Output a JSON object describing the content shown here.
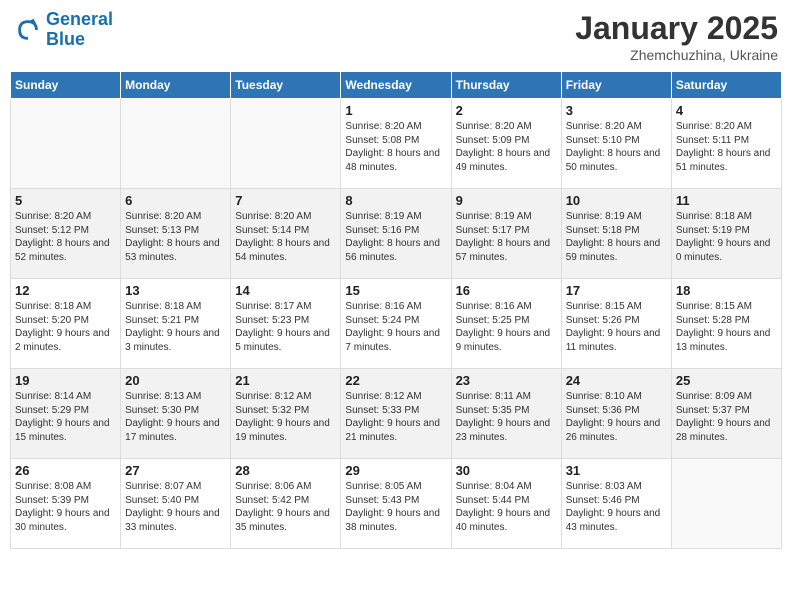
{
  "logo": {
    "line1": "General",
    "line2": "Blue"
  },
  "title": "January 2025",
  "subtitle": "Zhemchuzhina, Ukraine",
  "days_of_week": [
    "Sunday",
    "Monday",
    "Tuesday",
    "Wednesday",
    "Thursday",
    "Friday",
    "Saturday"
  ],
  "weeks": [
    [
      {
        "day": "",
        "sunrise": "",
        "sunset": "",
        "daylight": ""
      },
      {
        "day": "",
        "sunrise": "",
        "sunset": "",
        "daylight": ""
      },
      {
        "day": "",
        "sunrise": "",
        "sunset": "",
        "daylight": ""
      },
      {
        "day": "1",
        "sunrise": "Sunrise: 8:20 AM",
        "sunset": "Sunset: 5:08 PM",
        "daylight": "Daylight: 8 hours and 48 minutes."
      },
      {
        "day": "2",
        "sunrise": "Sunrise: 8:20 AM",
        "sunset": "Sunset: 5:09 PM",
        "daylight": "Daylight: 8 hours and 49 minutes."
      },
      {
        "day": "3",
        "sunrise": "Sunrise: 8:20 AM",
        "sunset": "Sunset: 5:10 PM",
        "daylight": "Daylight: 8 hours and 50 minutes."
      },
      {
        "day": "4",
        "sunrise": "Sunrise: 8:20 AM",
        "sunset": "Sunset: 5:11 PM",
        "daylight": "Daylight: 8 hours and 51 minutes."
      }
    ],
    [
      {
        "day": "5",
        "sunrise": "Sunrise: 8:20 AM",
        "sunset": "Sunset: 5:12 PM",
        "daylight": "Daylight: 8 hours and 52 minutes."
      },
      {
        "day": "6",
        "sunrise": "Sunrise: 8:20 AM",
        "sunset": "Sunset: 5:13 PM",
        "daylight": "Daylight: 8 hours and 53 minutes."
      },
      {
        "day": "7",
        "sunrise": "Sunrise: 8:20 AM",
        "sunset": "Sunset: 5:14 PM",
        "daylight": "Daylight: 8 hours and 54 minutes."
      },
      {
        "day": "8",
        "sunrise": "Sunrise: 8:19 AM",
        "sunset": "Sunset: 5:16 PM",
        "daylight": "Daylight: 8 hours and 56 minutes."
      },
      {
        "day": "9",
        "sunrise": "Sunrise: 8:19 AM",
        "sunset": "Sunset: 5:17 PM",
        "daylight": "Daylight: 8 hours and 57 minutes."
      },
      {
        "day": "10",
        "sunrise": "Sunrise: 8:19 AM",
        "sunset": "Sunset: 5:18 PM",
        "daylight": "Daylight: 8 hours and 59 minutes."
      },
      {
        "day": "11",
        "sunrise": "Sunrise: 8:18 AM",
        "sunset": "Sunset: 5:19 PM",
        "daylight": "Daylight: 9 hours and 0 minutes."
      }
    ],
    [
      {
        "day": "12",
        "sunrise": "Sunrise: 8:18 AM",
        "sunset": "Sunset: 5:20 PM",
        "daylight": "Daylight: 9 hours and 2 minutes."
      },
      {
        "day": "13",
        "sunrise": "Sunrise: 8:18 AM",
        "sunset": "Sunset: 5:21 PM",
        "daylight": "Daylight: 9 hours and 3 minutes."
      },
      {
        "day": "14",
        "sunrise": "Sunrise: 8:17 AM",
        "sunset": "Sunset: 5:23 PM",
        "daylight": "Daylight: 9 hours and 5 minutes."
      },
      {
        "day": "15",
        "sunrise": "Sunrise: 8:16 AM",
        "sunset": "Sunset: 5:24 PM",
        "daylight": "Daylight: 9 hours and 7 minutes."
      },
      {
        "day": "16",
        "sunrise": "Sunrise: 8:16 AM",
        "sunset": "Sunset: 5:25 PM",
        "daylight": "Daylight: 9 hours and 9 minutes."
      },
      {
        "day": "17",
        "sunrise": "Sunrise: 8:15 AM",
        "sunset": "Sunset: 5:26 PM",
        "daylight": "Daylight: 9 hours and 11 minutes."
      },
      {
        "day": "18",
        "sunrise": "Sunrise: 8:15 AM",
        "sunset": "Sunset: 5:28 PM",
        "daylight": "Daylight: 9 hours and 13 minutes."
      }
    ],
    [
      {
        "day": "19",
        "sunrise": "Sunrise: 8:14 AM",
        "sunset": "Sunset: 5:29 PM",
        "daylight": "Daylight: 9 hours and 15 minutes."
      },
      {
        "day": "20",
        "sunrise": "Sunrise: 8:13 AM",
        "sunset": "Sunset: 5:30 PM",
        "daylight": "Daylight: 9 hours and 17 minutes."
      },
      {
        "day": "21",
        "sunrise": "Sunrise: 8:12 AM",
        "sunset": "Sunset: 5:32 PM",
        "daylight": "Daylight: 9 hours and 19 minutes."
      },
      {
        "day": "22",
        "sunrise": "Sunrise: 8:12 AM",
        "sunset": "Sunset: 5:33 PM",
        "daylight": "Daylight: 9 hours and 21 minutes."
      },
      {
        "day": "23",
        "sunrise": "Sunrise: 8:11 AM",
        "sunset": "Sunset: 5:35 PM",
        "daylight": "Daylight: 9 hours and 23 minutes."
      },
      {
        "day": "24",
        "sunrise": "Sunrise: 8:10 AM",
        "sunset": "Sunset: 5:36 PM",
        "daylight": "Daylight: 9 hours and 26 minutes."
      },
      {
        "day": "25",
        "sunrise": "Sunrise: 8:09 AM",
        "sunset": "Sunset: 5:37 PM",
        "daylight": "Daylight: 9 hours and 28 minutes."
      }
    ],
    [
      {
        "day": "26",
        "sunrise": "Sunrise: 8:08 AM",
        "sunset": "Sunset: 5:39 PM",
        "daylight": "Daylight: 9 hours and 30 minutes."
      },
      {
        "day": "27",
        "sunrise": "Sunrise: 8:07 AM",
        "sunset": "Sunset: 5:40 PM",
        "daylight": "Daylight: 9 hours and 33 minutes."
      },
      {
        "day": "28",
        "sunrise": "Sunrise: 8:06 AM",
        "sunset": "Sunset: 5:42 PM",
        "daylight": "Daylight: 9 hours and 35 minutes."
      },
      {
        "day": "29",
        "sunrise": "Sunrise: 8:05 AM",
        "sunset": "Sunset: 5:43 PM",
        "daylight": "Daylight: 9 hours and 38 minutes."
      },
      {
        "day": "30",
        "sunrise": "Sunrise: 8:04 AM",
        "sunset": "Sunset: 5:44 PM",
        "daylight": "Daylight: 9 hours and 40 minutes."
      },
      {
        "day": "31",
        "sunrise": "Sunrise: 8:03 AM",
        "sunset": "Sunset: 5:46 PM",
        "daylight": "Daylight: 9 hours and 43 minutes."
      },
      {
        "day": "",
        "sunrise": "",
        "sunset": "",
        "daylight": ""
      }
    ]
  ]
}
